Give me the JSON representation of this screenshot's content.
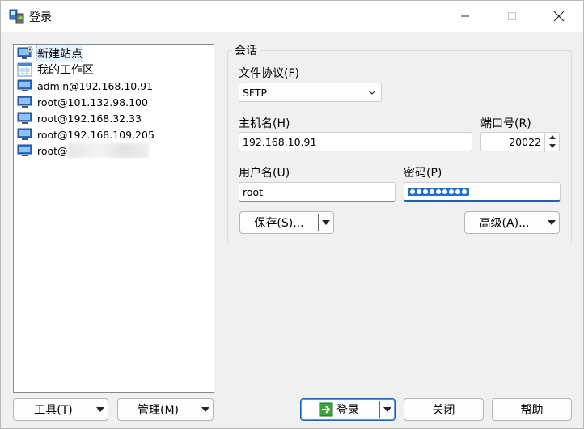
{
  "window": {
    "title": "登录"
  },
  "sites": [
    {
      "label": "新建站点",
      "type": "new",
      "selected": true
    },
    {
      "label": "我的工作区",
      "type": "workspace"
    },
    {
      "label": "admin@192.168.10.91",
      "type": "site"
    },
    {
      "label": "root@101.132.98.100",
      "type": "site"
    },
    {
      "label": "root@192.168.32.33",
      "type": "site"
    },
    {
      "label": "root@192.168.109.205",
      "type": "site"
    },
    {
      "label": "root@",
      "type": "site",
      "redacted": true
    }
  ],
  "session": {
    "group_title": "会话",
    "protocol_label": "文件协议(F)",
    "protocol_value": "SFTP",
    "host_label": "主机名(H)",
    "host_value": "192.168.10.91",
    "port_label": "端口号(R)",
    "port_value": "20022",
    "user_label": "用户名(U)",
    "user_value": "root",
    "password_label": "密码(P)",
    "password_length": 9,
    "save_label": "保存(S)...",
    "advanced_label": "高级(A)..."
  },
  "footer": {
    "tools_label": "工具(T)",
    "manage_label": "管理(M)",
    "login_label": "登录",
    "close_label": "关闭",
    "help_label": "帮助"
  },
  "colors": {
    "accent": "#1a63b8",
    "selection": "#1e6fd0",
    "login_icon": "#3aa33a"
  }
}
